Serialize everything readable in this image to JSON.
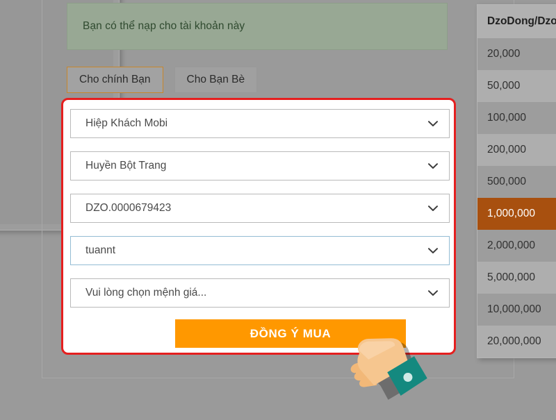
{
  "notice": {
    "text": "Bạn có thể nạp cho tài khoản này"
  },
  "tabs": [
    {
      "label": "Cho chính Bạn",
      "active": true
    },
    {
      "label": "Cho Bạn Bè",
      "active": false
    }
  ],
  "form": {
    "fields": [
      {
        "name": "game-select",
        "value": "Hiệp Khách Mobi",
        "focused": false
      },
      {
        "name": "server-select",
        "value": "Huyền Bột Trang",
        "focused": false
      },
      {
        "name": "account-select",
        "value": "DZO.0000679423",
        "focused": false
      },
      {
        "name": "character-select",
        "value": "tuannt",
        "focused": true
      },
      {
        "name": "amount-select",
        "value": "Vui lòng chọn mệnh giá...",
        "focused": false
      }
    ],
    "submit_label": "ĐỒNG Ý MUA",
    "accent_color": "#ff9800",
    "highlight_border_color": "#e51f1f",
    "focus_border_color": "#93bcd4"
  },
  "denominations": {
    "header": "DzoDong/Dzo",
    "selected_color": "#a8500f",
    "rows": [
      "20,000",
      "50,000",
      "100,000",
      "200,000",
      "500,000",
      "1,000,000",
      "2,000,000",
      "5,000,000",
      "10,000,000",
      "20,000,000"
    ],
    "selected_index": 5
  },
  "cursor": {
    "type": "pointing-hand",
    "skin_color": "#f6c68f",
    "cuff_color": "#14897f"
  }
}
